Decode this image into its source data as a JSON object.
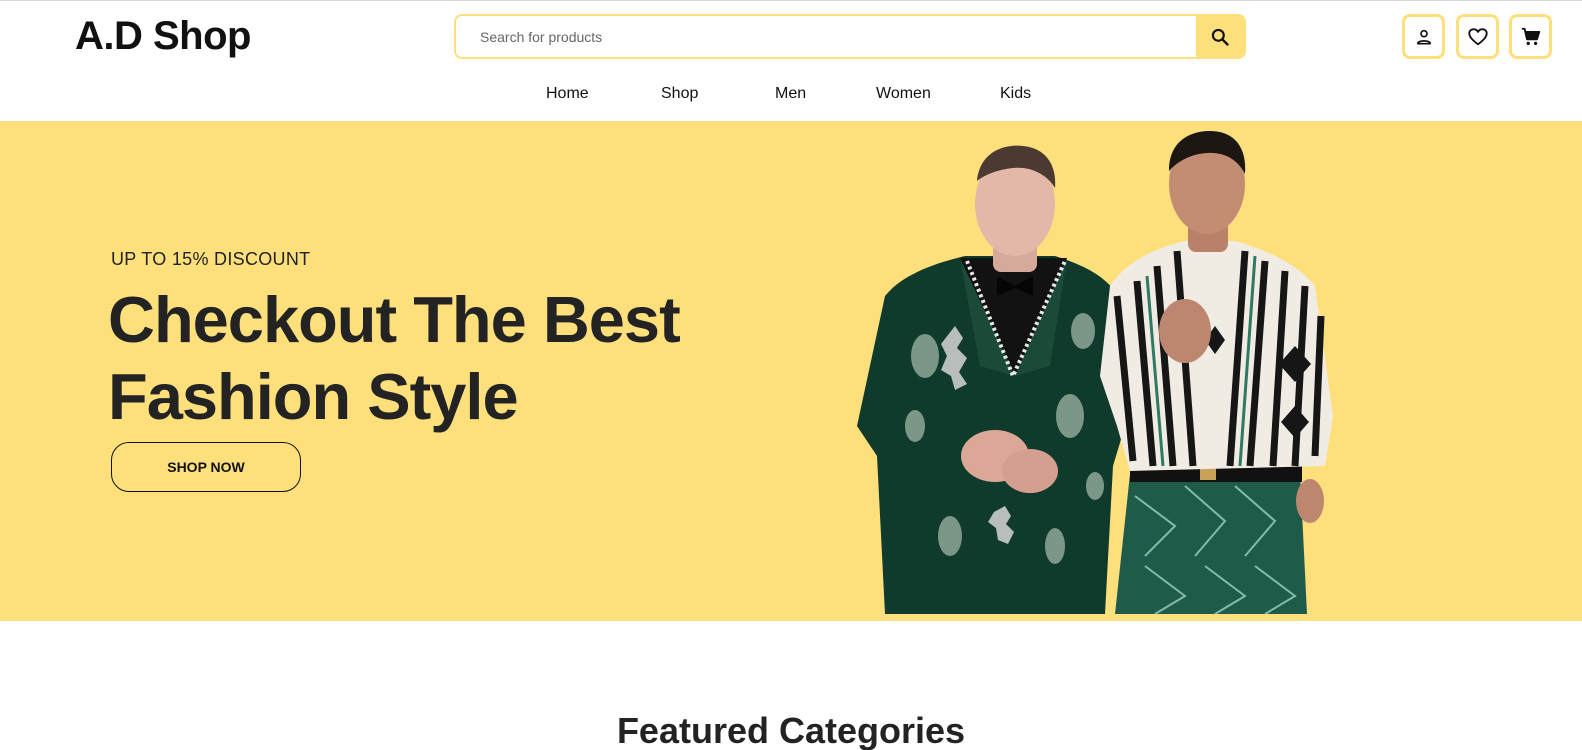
{
  "brand": {
    "logo": "A.D Shop"
  },
  "search": {
    "placeholder": "Search for products",
    "button_icon": "search-icon"
  },
  "header_icons": [
    {
      "name": "user-icon"
    },
    {
      "name": "heart-icon"
    },
    {
      "name": "cart-icon"
    }
  ],
  "nav": {
    "items": [
      {
        "label": "Home"
      },
      {
        "label": "Shop"
      },
      {
        "label": "Men"
      },
      {
        "label": "Women"
      },
      {
        "label": "Kids"
      }
    ]
  },
  "hero": {
    "kicker": "UP TO 15% DISCOUNT",
    "title_line1": "Checkout The Best",
    "title_line2": "Fashion Style",
    "cta_label": "SHOP NOW",
    "background_color": "#fde07b"
  },
  "featured": {
    "title": "Featured Categories"
  },
  "colors": {
    "accent": "#fde07b",
    "text": "#232323"
  }
}
